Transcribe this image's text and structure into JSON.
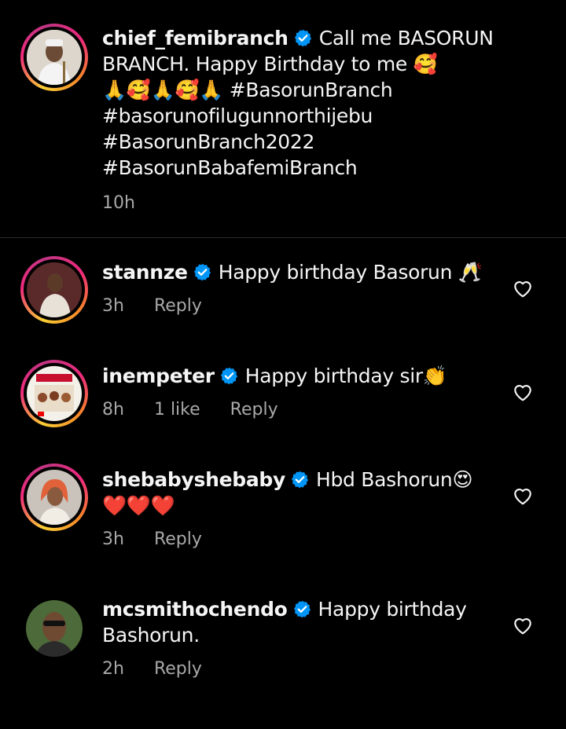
{
  "caption": {
    "username": "chief_femibranch",
    "line1": "Call me BASORUN BRANCH. Happy Birthday to me 🥰",
    "line2": "🙏🥰🙏🥰🙏 #BasorunBranch",
    "line3": "#basorunofilugunnorthijebu",
    "line4": "#BasorunBranch2022",
    "line5": "#BasorunBabafemiBranch",
    "time": "10h"
  },
  "comments": [
    {
      "username": "stannze",
      "text": "Happy birthday Basorun 🥂",
      "time": "3h",
      "likes": "",
      "reply": "Reply"
    },
    {
      "username": "inempeter",
      "text": "Happy birthday sir👏",
      "time": "8h",
      "likes": "1 like",
      "reply": "Reply"
    },
    {
      "username": "shebabyshebaby",
      "text": "Hbd Bashorun😍❤️❤️❤️",
      "time": "3h",
      "likes": "",
      "reply": "Reply"
    },
    {
      "username": "mcsmithochendo",
      "text": "Happy birthday Bashorun.",
      "time": "2h",
      "likes": "",
      "reply": "Reply"
    }
  ],
  "colors": {
    "verified": "#0095f6",
    "meta_text": "#a8a8a8",
    "background": "#000000"
  }
}
